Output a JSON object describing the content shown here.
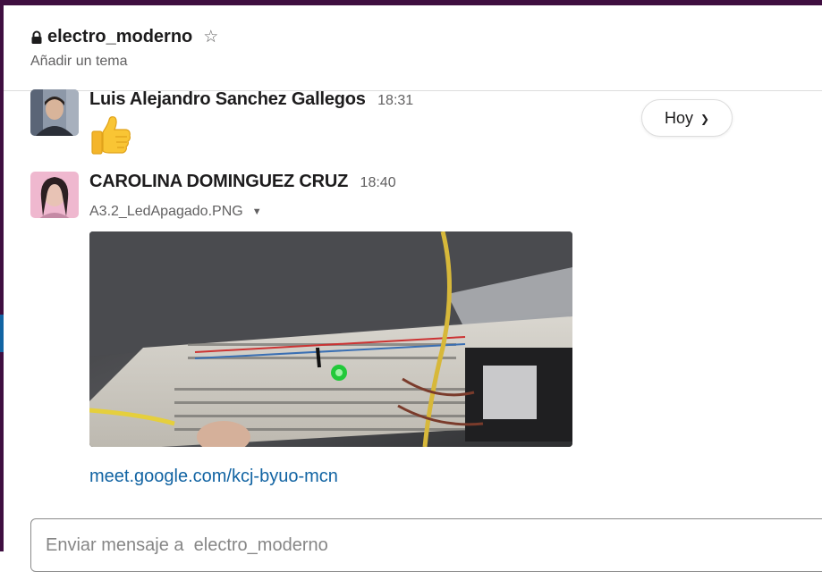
{
  "channel": {
    "name": "electro_moderno",
    "topic_placeholder": "Añadir un tema"
  },
  "day_divider": {
    "label": "Hoy"
  },
  "messages": [
    {
      "sender": "Luis Alejandro Sanchez Gallegos",
      "time": "18:31",
      "content_emoji": "thumbs-up"
    },
    {
      "sender": "CAROLINA DOMINGUEZ CRUZ",
      "time": "18:40",
      "file_name": "A3.2_LedApagado.PNG",
      "link": "meet.google.com/kcj-byuo-mcn"
    }
  ],
  "composer": {
    "placeholder": "Enviar mensaje a  electro_moderno"
  },
  "colors": {
    "sidebar": "#3f0e40",
    "link": "#1264a3",
    "muted_text": "#616061"
  }
}
